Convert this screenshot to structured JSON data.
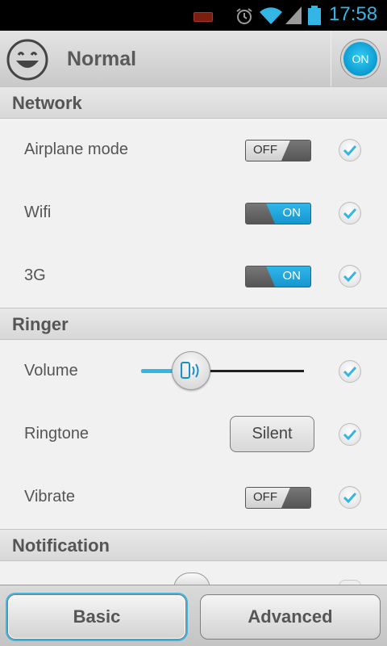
{
  "status_bar": {
    "time": "17:58",
    "icons": [
      "battery-warning-icon",
      "alarm-icon",
      "wifi-icon",
      "signal-icon",
      "battery-icon"
    ]
  },
  "header": {
    "profile_name": "Normal",
    "power_button_label": "ON",
    "icon": "smiley-icon"
  },
  "sections": {
    "network": {
      "title": "Network",
      "airplane": {
        "label": "Airplane mode",
        "toggle": "OFF",
        "checked": true
      },
      "wifi": {
        "label": "Wifi",
        "toggle": "ON",
        "checked": true
      },
      "g3": {
        "label": "3G",
        "toggle": "ON",
        "checked": true
      }
    },
    "ringer": {
      "title": "Ringer",
      "volume": {
        "label": "Volume",
        "level": 0.3,
        "checked": true
      },
      "ringtone": {
        "label": "Ringtone",
        "value": "Silent",
        "checked": true
      },
      "vibrate": {
        "label": "Vibrate",
        "toggle": "OFF",
        "checked": true
      }
    },
    "notification": {
      "title": "Notification"
    }
  },
  "bottom_tabs": {
    "basic": "Basic",
    "advanced": "Advanced"
  },
  "colors": {
    "accent": "#33b5e5",
    "header_text": "#5a5a5a"
  }
}
